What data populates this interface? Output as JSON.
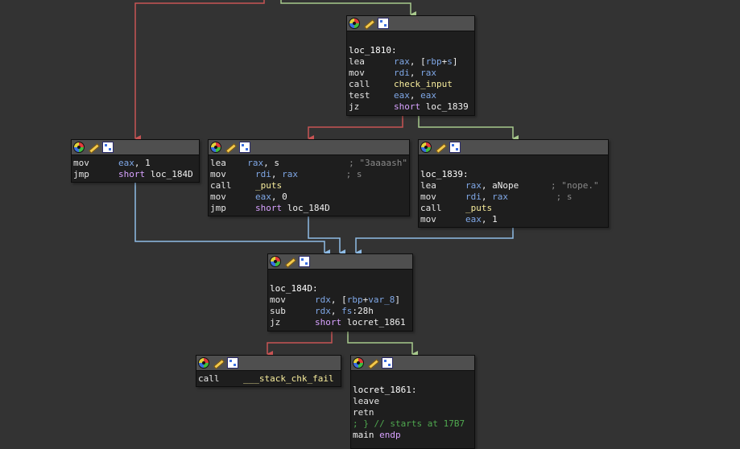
{
  "colors": {
    "background": "#333333",
    "edge_false": "#c85454",
    "edge_true": "#a8c98d",
    "edge_uncond": "#8fbce6"
  },
  "header_icons": [
    "color-icon",
    "rename-icon",
    "graph-overview-icon"
  ],
  "blocks": {
    "b1810": {
      "label": "loc_1810:",
      "lines": [
        {
          "mn": "lea",
          "ops": [
            {
              "t": "rax",
              "c": "reg"
            },
            {
              "t": ", [",
              "c": "txt"
            },
            {
              "t": "rbp",
              "c": "reg"
            },
            {
              "t": "+",
              "c": "txt"
            },
            {
              "t": "s",
              "c": "reg"
            },
            {
              "t": "]",
              "c": "txt"
            }
          ]
        },
        {
          "mn": "mov",
          "ops": [
            {
              "t": "rdi",
              "c": "reg"
            },
            {
              "t": ", ",
              "c": "txt"
            },
            {
              "t": "rax",
              "c": "reg"
            }
          ]
        },
        {
          "mn": "call",
          "ops": [
            {
              "t": "check_input",
              "c": "strc"
            }
          ]
        },
        {
          "mn": "test",
          "ops": [
            {
              "t": "eax",
              "c": "reg"
            },
            {
              "t": ", ",
              "c": "txt"
            },
            {
              "t": "eax",
              "c": "reg"
            }
          ]
        },
        {
          "mn": "jz",
          "ops": [
            {
              "t": "short ",
              "c": "kw"
            },
            {
              "t": "loc_1839",
              "c": "txt"
            }
          ]
        }
      ]
    },
    "bfail": {
      "label": "",
      "lines": [
        {
          "mn": "mov",
          "ops": [
            {
              "t": "eax",
              "c": "reg"
            },
            {
              "t": ", 1",
              "c": "txt"
            }
          ]
        },
        {
          "mn": "jmp",
          "ops": [
            {
              "t": "short ",
              "c": "kw"
            },
            {
              "t": "loc_184D",
              "c": "txt"
            }
          ]
        }
      ]
    },
    "bok": {
      "label": "",
      "lines": [
        {
          "mn": "lea",
          "ops": [
            {
              "t": "rax",
              "c": "reg"
            },
            {
              "t": ", s",
              "c": "txt"
            },
            {
              "t": "             ; \"3aaaash\"",
              "c": "cmt"
            }
          ]
        },
        {
          "mn": "mov",
          "ops": [
            {
              "t": "rdi",
              "c": "reg"
            },
            {
              "t": ", ",
              "c": "txt"
            },
            {
              "t": "rax",
              "c": "reg"
            },
            {
              "t": "         ; s",
              "c": "cmt"
            }
          ]
        },
        {
          "mn": "call",
          "ops": [
            {
              "t": "_puts",
              "c": "strc"
            }
          ]
        },
        {
          "mn": "mov",
          "ops": [
            {
              "t": "eax",
              "c": "reg"
            },
            {
              "t": ", 0",
              "c": "txt"
            }
          ]
        },
        {
          "mn": "jmp",
          "ops": [
            {
              "t": "short ",
              "c": "kw"
            },
            {
              "t": "loc_184D",
              "c": "txt"
            }
          ]
        }
      ]
    },
    "b1839": {
      "label": "loc_1839:",
      "lines": [
        {
          "mn": "lea",
          "ops": [
            {
              "t": "rax",
              "c": "reg"
            },
            {
              "t": ", aNope",
              "c": "txt"
            },
            {
              "t": "      ; \"nope.\"",
              "c": "cmt"
            }
          ]
        },
        {
          "mn": "mov",
          "ops": [
            {
              "t": "rdi",
              "c": "reg"
            },
            {
              "t": ", ",
              "c": "txt"
            },
            {
              "t": "rax",
              "c": "reg"
            },
            {
              "t": "         ; s",
              "c": "cmt"
            }
          ]
        },
        {
          "mn": "call",
          "ops": [
            {
              "t": "_puts",
              "c": "strc"
            }
          ]
        },
        {
          "mn": "mov",
          "ops": [
            {
              "t": "eax",
              "c": "reg"
            },
            {
              "t": ", 1",
              "c": "txt"
            }
          ]
        }
      ]
    },
    "b184D": {
      "label": "loc_184D:",
      "lines": [
        {
          "mn": "mov",
          "ops": [
            {
              "t": "rdx",
              "c": "reg"
            },
            {
              "t": ", [",
              "c": "txt"
            },
            {
              "t": "rbp",
              "c": "reg"
            },
            {
              "t": "+",
              "c": "txt"
            },
            {
              "t": "var_8",
              "c": "reg"
            },
            {
              "t": "]",
              "c": "txt"
            }
          ]
        },
        {
          "mn": "sub",
          "ops": [
            {
              "t": "rdx",
              "c": "reg"
            },
            {
              "t": ", ",
              "c": "txt"
            },
            {
              "t": "fs",
              "c": "reg"
            },
            {
              "t": ":28h",
              "c": "txt"
            }
          ]
        },
        {
          "mn": "jz",
          "ops": [
            {
              "t": "short ",
              "c": "kw"
            },
            {
              "t": "locret_1861",
              "c": "txt"
            }
          ]
        }
      ]
    },
    "bchk": {
      "label": "",
      "lines": [
        {
          "mn": "call",
          "ops": [
            {
              "t": "___stack_chk_fail",
              "c": "strc"
            }
          ]
        }
      ]
    },
    "bret": {
      "label": "locret_1861:",
      "lines": [
        {
          "mn": "leave",
          "ops": []
        },
        {
          "mn": "retn",
          "ops": []
        },
        {
          "mn": "",
          "raw": [
            {
              "t": "; } ",
              "c": "gcmt"
            },
            {
              "t": "// starts at 17B7",
              "c": "gcmt"
            }
          ]
        },
        {
          "mn": "",
          "raw": [
            {
              "t": "main ",
              "c": "txt"
            },
            {
              "t": "endp",
              "c": "kw"
            }
          ]
        }
      ]
    }
  }
}
